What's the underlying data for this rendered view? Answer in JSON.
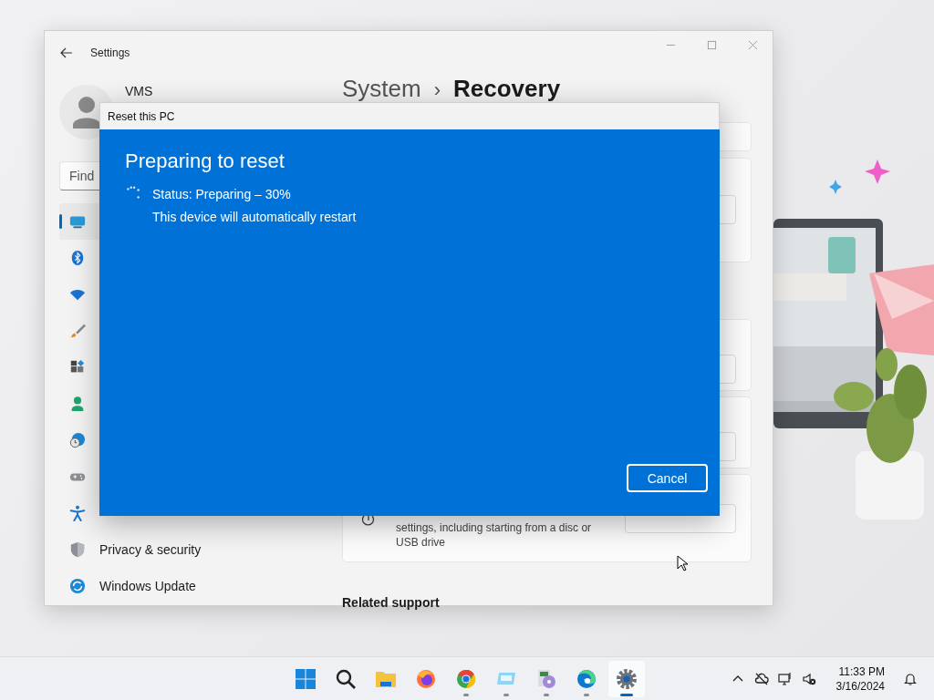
{
  "settings_window": {
    "title": "Settings",
    "user": {
      "name": "VMS"
    },
    "search": {
      "placeholder": "Find"
    },
    "nav_items": [
      {
        "kind": "display",
        "selected": true
      },
      {
        "kind": "bluetooth",
        "selected": false
      },
      {
        "kind": "wifi",
        "selected": false
      },
      {
        "kind": "brush",
        "selected": false
      },
      {
        "kind": "apps",
        "selected": false
      },
      {
        "kind": "account",
        "selected": false
      },
      {
        "kind": "time",
        "selected": false
      },
      {
        "kind": "gaming",
        "selected": false
      },
      {
        "kind": "accessibility",
        "selected": false
      },
      {
        "kind": "privacy",
        "label": "Privacy & security",
        "selected": false
      },
      {
        "kind": "update",
        "label": "Windows Update",
        "selected": false
      }
    ],
    "breadcrumb": {
      "parent": "System",
      "separator": "›",
      "current": "Recovery"
    },
    "recovery_option": {
      "description": "settings, including starting from a disc or USB drive"
    },
    "related_support": "Related support"
  },
  "dialog": {
    "title": "Reset this PC",
    "heading": "Preparing to reset",
    "status": "Status: Preparing – 30%",
    "note": "This device will automatically restart",
    "cancel_button": "Cancel"
  },
  "taskbar": {
    "apps": [
      {
        "kind": "start",
        "running": false,
        "selected": false
      },
      {
        "kind": "search",
        "running": false,
        "selected": false
      },
      {
        "kind": "files",
        "running": false,
        "selected": false
      },
      {
        "kind": "firefox",
        "running": false,
        "selected": false
      },
      {
        "kind": "chrome",
        "running": true,
        "selected": false
      },
      {
        "kind": "monitor",
        "running": true,
        "selected": false
      },
      {
        "kind": "installer",
        "running": true,
        "selected": false
      },
      {
        "kind": "edge",
        "running": true,
        "selected": false
      },
      {
        "kind": "settings",
        "running": true,
        "selected": true
      }
    ],
    "clock": {
      "time": "11:33 PM",
      "date": "3/16/2024"
    }
  }
}
